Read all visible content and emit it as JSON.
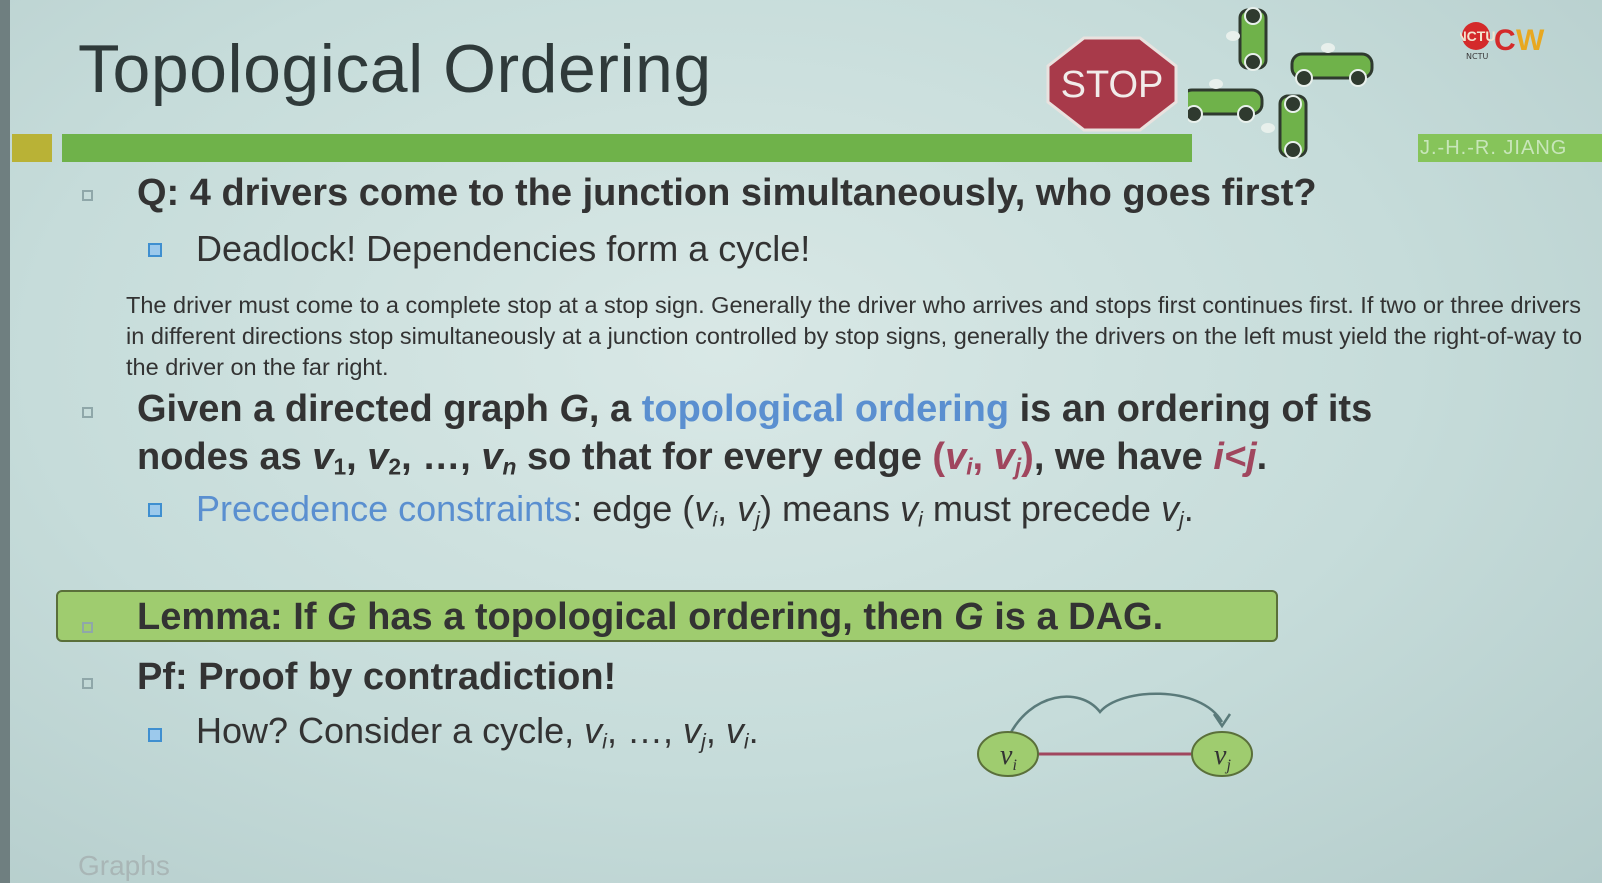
{
  "slide": {
    "title": "Topological Ordering",
    "stop_sign": "STOP",
    "logo_text": "OCW",
    "logo_sub": "NCTU",
    "author_tag": "J.-H.-R. JIANG",
    "footer": "Graphs"
  },
  "question": {
    "text": "Q: 4 drivers come to the junction simultaneously, who goes first?",
    "sub": "Deadlock! Dependencies form a cycle!"
  },
  "paragraph": "The driver must come to a complete stop at a stop sign. Generally the driver who arrives and stops first continues first. If two or three drivers in different directions stop simultaneously at a junction controlled by stop signs, generally the drivers on the left must yield the right-of-way to the driver on the far right.",
  "definition": {
    "p1": "Given a directed graph ",
    "G": "G",
    "p2": ", a ",
    "term": "topological ordering",
    "p3": " is an ordering of its",
    "p4": "nodes as ",
    "v": "v",
    "s1": "1",
    "s2": "2",
    "sn": "n",
    "c1": ", ",
    "c2": ", …, ",
    "p5": " so that for every edge ",
    "edge_open": "(",
    "edge_mid": ", ",
    "edge_close": ")",
    "vi": "v",
    "si": "i",
    "vj": "v",
    "sj": "j",
    "p6": ", we have ",
    "cond": "i<j",
    "p7": "."
  },
  "precedence": {
    "term": "Precedence constraints",
    "p1": ": edge (",
    "p2": ", ",
    "p3": ") means ",
    "p4": " must precede ",
    "p5": ".",
    "v": "v",
    "i": "i",
    "j": "j"
  },
  "lemma": {
    "p1": "Lemma: If ",
    "G1": "G",
    "p2": " has a topological ordering, then ",
    "G2": "G",
    "p3": " is a DAG."
  },
  "proof": {
    "title": "Pf: Proof by contradiction!",
    "how_p1": "How? Consider a cycle, ",
    "v": "v",
    "i": "i",
    "j": "j",
    "sep1": ", …, ",
    "sep2": ", ",
    "end": "."
  },
  "diagram": {
    "node_left": "v",
    "node_left_sub": "i",
    "node_right": "v",
    "node_right_sub": "j",
    "colors": {
      "node_fill": "#9fcc6f",
      "arrow": "#a0465e",
      "curve": "#5a7a7a"
    }
  },
  "colors": {
    "accent_bar": "#6fb24a",
    "highlight_blue": "#5a8fd0",
    "highlight_red": "#a0465e",
    "stop_red": "#a83a4a"
  }
}
